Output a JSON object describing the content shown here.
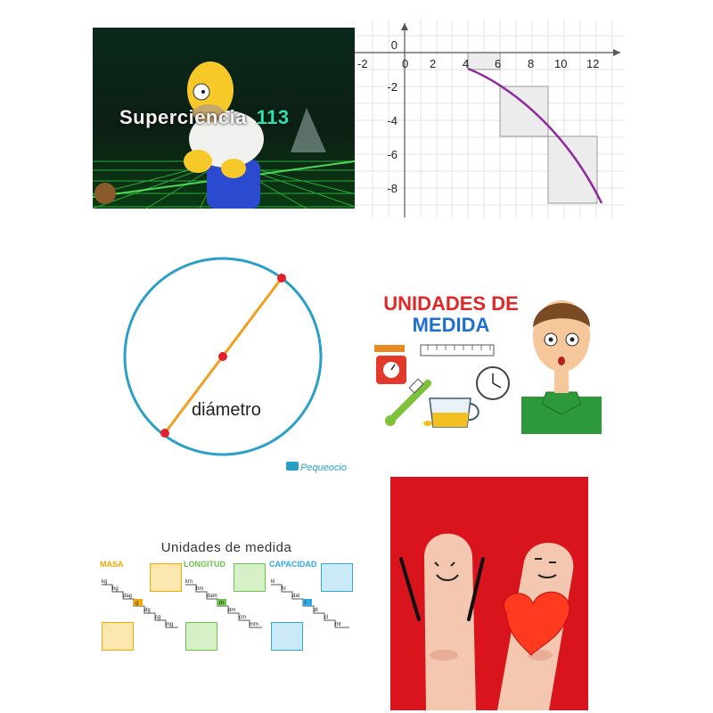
{
  "tiles": {
    "superciencia": {
      "title_word": "Superciencia",
      "episode": "113"
    },
    "graph": {
      "x_ticks": [
        "-2",
        "0",
        "2",
        "4",
        "6",
        "8",
        "10",
        "12"
      ],
      "y_ticks": [
        "0",
        "-2",
        "-4",
        "-6",
        "-8"
      ]
    },
    "circle": {
      "label": "diámetro",
      "watermark": "Pequeocio"
    },
    "unidades": {
      "line1": "UNIDADES DE",
      "line2": "MEDIDA"
    },
    "tabla": {
      "title": "Unidades de medida",
      "columns": [
        {
          "name": "MASA",
          "color": "#f2a900",
          "steps": [
            "kg",
            "hg",
            "dag",
            "g",
            "dg",
            "cg",
            "mg"
          ]
        },
        {
          "name": "LONGITUD",
          "color": "#6cc24a",
          "steps": [
            "km",
            "hm",
            "dam",
            "m",
            "dm",
            "cm",
            "mm"
          ]
        },
        {
          "name": "CAPACIDAD",
          "color": "#2fa8e0",
          "steps": [
            "kl",
            "hl",
            "dal",
            "l",
            "dl",
            "cl",
            "ml"
          ]
        }
      ]
    }
  }
}
